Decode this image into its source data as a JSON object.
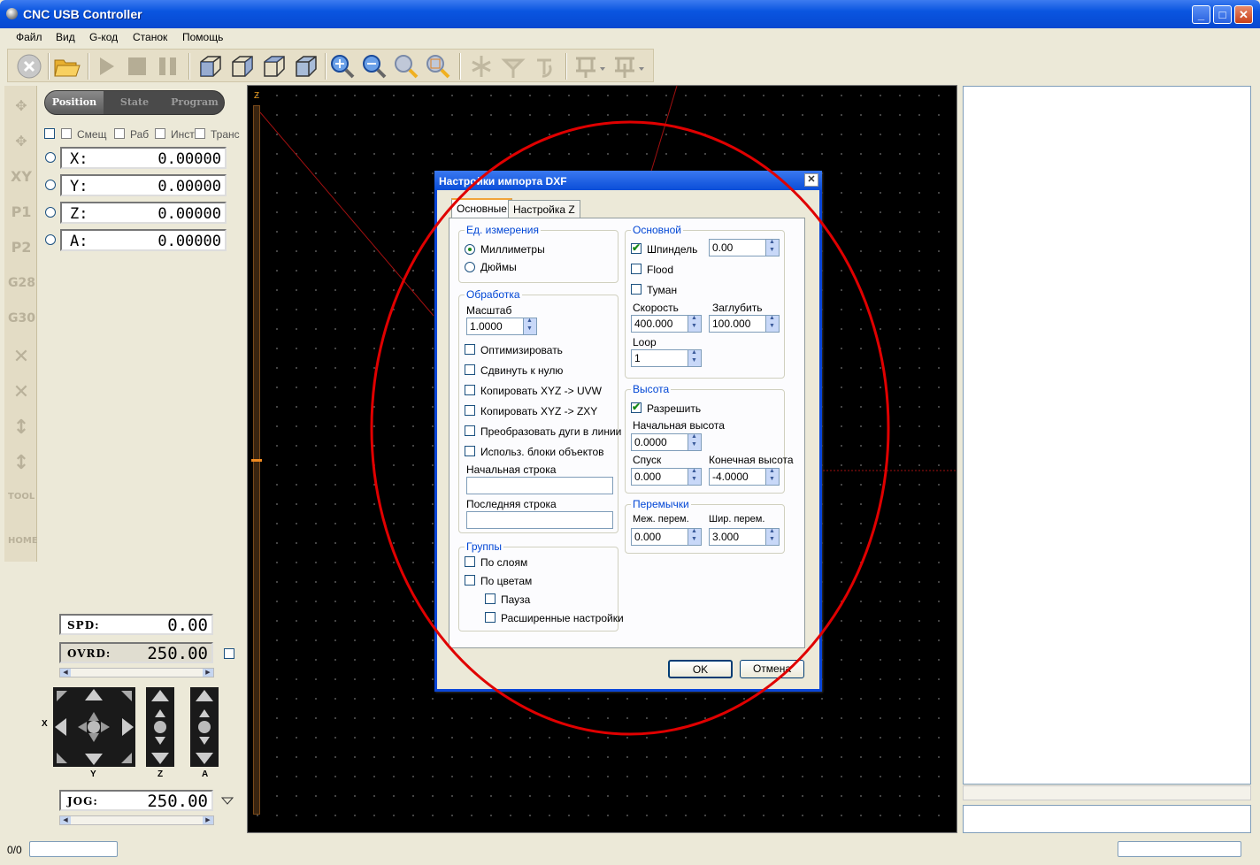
{
  "window": {
    "title": "CNC USB Controller",
    "min": "_",
    "max": "□",
    "close": "✕"
  },
  "menu": [
    "Файл",
    "Вид",
    "G-код",
    "Станок",
    "Помощь"
  ],
  "toolbar": [
    "stop-icon",
    "open-icon",
    "play-icon",
    "stop-square-icon",
    "pause-icon",
    "cube-front-icon",
    "cube-side-icon",
    "cube-iso-icon",
    "cube-top-icon",
    "zoom-in-icon",
    "zoom-out-icon",
    "zoom-fit-icon",
    "zoom-window-icon",
    "probe-icon",
    "tool-probe-icon",
    "tool-change-icon",
    "fixture-icon",
    "fixture2-icon"
  ],
  "left_tools": [
    "XY",
    "P1",
    "P2",
    "G28",
    "G30",
    "HOME",
    "TOOL"
  ],
  "position_tabs": [
    "Position",
    "State",
    "Program"
  ],
  "coord_flags": [
    "Смещ",
    "Раб",
    "Инст",
    "Транс"
  ],
  "axes": [
    {
      "label": "X:",
      "value": "0.00000"
    },
    {
      "label": "Y:",
      "value": "0.00000"
    },
    {
      "label": "Z:",
      "value": "0.00000"
    },
    {
      "label": "A:",
      "value": "0.00000"
    }
  ],
  "spd": {
    "label": "SPD:",
    "value": "0.00"
  },
  "ovrd": {
    "label": "OVRD:",
    "value": "250.00"
  },
  "jog": {
    "label": "JOG:",
    "value": "250.00"
  },
  "jog_labels": {
    "x": "X",
    "y": "Y",
    "z": "Z",
    "a": "A"
  },
  "canvas": {
    "axis_label": "Z"
  },
  "status": {
    "counter": "0/0"
  },
  "dialog": {
    "title": "Настройки импорта DXF",
    "tabs": [
      "Основные",
      "Настройка Z"
    ],
    "units": {
      "title": "Ед. измерения",
      "mm": "Миллиметры",
      "inch": "Дюймы",
      "selected": "mm"
    },
    "processing": {
      "title": "Обработка",
      "scale_label": "Масштаб",
      "scale": "1.0000",
      "options": [
        "Оптимизировать",
        "Сдвинуть к нулю",
        "Копировать XYZ -> UVW",
        "Копировать XYZ -> ZXY",
        "Преобразовать дуги в линии",
        "Использ. блоки объектов"
      ],
      "start_line_label": "Начальная строка",
      "start_line": "",
      "end_line_label": "Последняя строка",
      "end_line": ""
    },
    "groups": {
      "title": "Группы",
      "by_layers": "По слоям",
      "by_colors": "По цветам",
      "pause": "Пауза",
      "advanced": "Расширенные настройки"
    },
    "main": {
      "title": "Основной",
      "spindle": "Шпиндель",
      "spindle_value": "0.00",
      "flood": "Flood",
      "mist": "Туман",
      "speed_label": "Скорость",
      "speed": "400.000",
      "depth_label": "Заглубить",
      "depth": "100.000",
      "loop_label": "Loop",
      "loop": "1"
    },
    "height": {
      "title": "Высота",
      "enable": "Разрешить",
      "start_label": "Начальная высота",
      "start": "0.0000",
      "descent_label": "Спуск",
      "descent": "0.000",
      "end_label": "Конечная высота",
      "end": "-4.0000"
    },
    "bridges": {
      "title": "Перемычки",
      "dist_label": "Меж. перем.",
      "dist": "0.000",
      "width_label": "Шир. перем.",
      "width": "3.000"
    },
    "ok": "OK",
    "cancel": "Отмена"
  },
  "colors": {
    "accent": "#0a46d8",
    "annotation": "#e00000"
  }
}
